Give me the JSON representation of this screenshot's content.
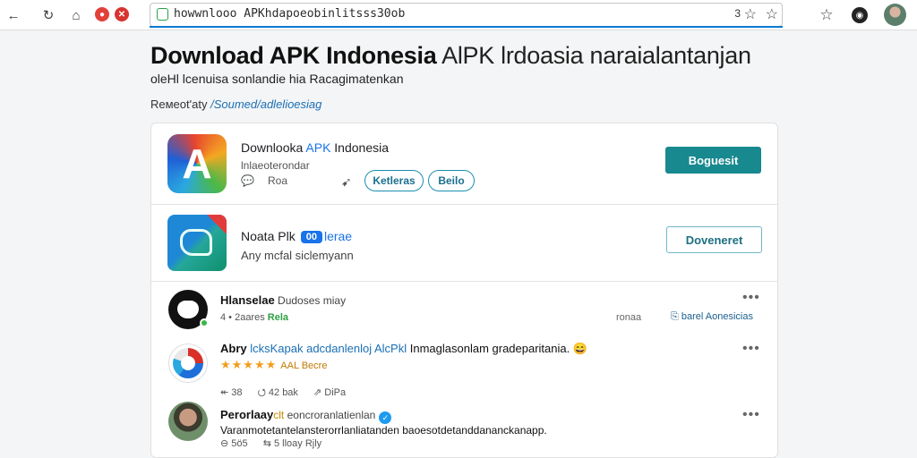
{
  "browser": {
    "url": "howwnlooo APKhdapoeobinlitsss30ob",
    "url_count": "3",
    "icons": [
      "back-arrow-icon",
      "refresh-icon",
      "home-icon",
      "extension-icon",
      "extension-close-icon",
      "lock-icon",
      "star-icon",
      "bookmark-star-icon",
      "profile-icon"
    ]
  },
  "header": {
    "title_bold": "Download APK Indonesia",
    "title_thin": " AlPK lrdoasia naraialantanjan",
    "subtitle": "oleHl lcenuisa sonlandie hia Racagimatenkan",
    "remark_prefix": "Rемеоt'aty ",
    "remark_link": "/Soumed/adlelioesiag"
  },
  "apps": [
    {
      "name_prefix": "Downlooka ",
      "name_accent": "APK",
      "name_suffix": " Indonesia",
      "sub": "lnlaeoterondar",
      "meta_1": "Roa",
      "pill_1": "Ketleras",
      "pill_2": "Beilo",
      "button": "Boguesit"
    },
    {
      "name": "Noata Plk",
      "badge": "00",
      "badge_after": "lerae",
      "sub": "Any mcfal siclemyann",
      "button": "Doveneret"
    }
  ],
  "posts": [
    {
      "author": "Hlanselae",
      "handle": " Dudoses miay",
      "meta": "4 • 2aares ",
      "meta_green": "Rela",
      "right_grey": "ronaa",
      "right_link": "barel Aonesicias"
    },
    {
      "author": "Abry ",
      "text_blue": "lcksKapak adcdanlenloj AlcPkl",
      "text_rest": " Inmaglasonlam gradeparitania. 😄",
      "stars": "★★★★★",
      "stars_after": "AAL Becre",
      "actions": [
        "↞ 38",
        "⭯ 42 bak",
        "⇗ DiPa"
      ]
    },
    {
      "author": "Perorlaay",
      "handle_orange": "clt",
      "handle": " eoncroranlatienlan",
      "text": "Varanmotetantelansterorrlanliatanden baoesotdetanddananckanapp.",
      "actions": [
        "⊖ 5ö5",
        "⇆ 5 lloay Rjly"
      ]
    }
  ]
}
